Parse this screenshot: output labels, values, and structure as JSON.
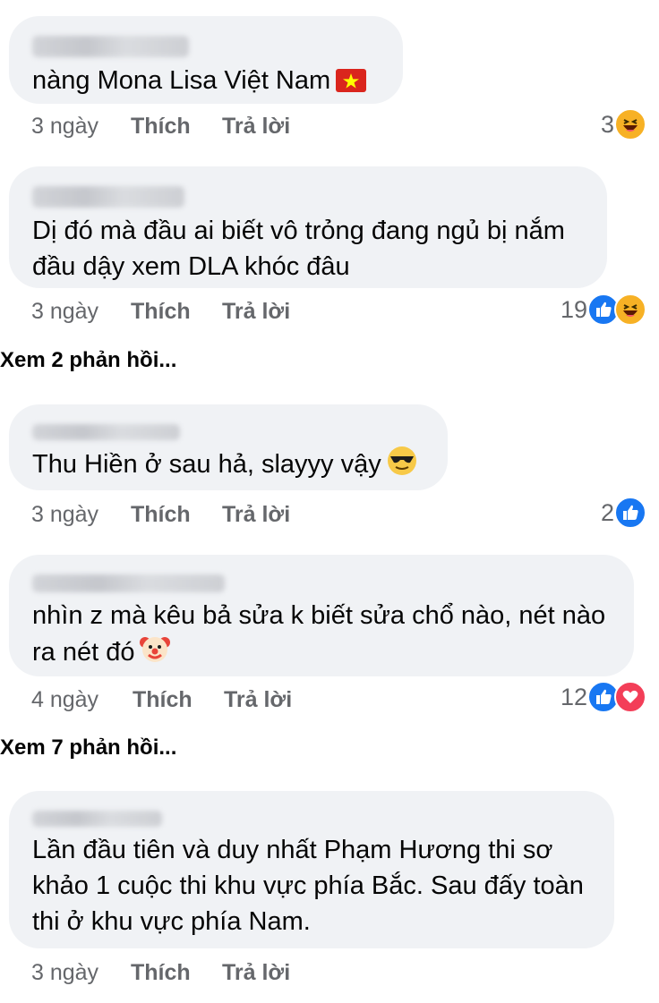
{
  "comments": [
    {
      "text": "nàng Mona Lisa Việt Nam",
      "time": "3 ngày",
      "like_label": "Thích",
      "reply_label": "Trả lời",
      "reaction_count": "3",
      "reactions": [
        "haha-icon"
      ]
    },
    {
      "text": "Dị đó mà đầu ai biết vô trỏng đang ngủ bị nắm đầu dậy xem DLA khóc đâu",
      "time": "3 ngày",
      "like_label": "Thích",
      "reply_label": "Trả lời",
      "reaction_count": "19",
      "reactions": [
        "like-icon",
        "haha-icon"
      ]
    },
    {
      "text": "Thu Hiền ở sau hả, slayyy vậy",
      "time": "3 ngày",
      "like_label": "Thích",
      "reply_label": "Trả lời",
      "reaction_count": "2",
      "reactions": [
        "like-icon"
      ]
    },
    {
      "text": "nhìn z mà kêu bả sửa k biết sửa chổ nào, nét nào ra nét đó",
      "time": "4 ngày",
      "like_label": "Thích",
      "reply_label": "Trả lời",
      "reaction_count": "12",
      "reactions": [
        "like-icon",
        "love-icon"
      ]
    },
    {
      "text": "Lần đầu tiên và duy nhất Phạm Hương thi sơ khảo 1 cuộc thi khu vực phía Bắc. Sau đấy toàn thi ở khu vực phía Nam.",
      "time": "3 ngày",
      "like_label": "Thích",
      "reply_label": "Trả lời"
    }
  ],
  "view_more": [
    "Xem 2 phản hồi...",
    "Xem 7 phản hồi..."
  ],
  "colors": {
    "bubble": "#f0f2f5",
    "meta": "#65676b",
    "like": "#1877f2",
    "love": "#f33e58",
    "haha": "#f7b125"
  }
}
